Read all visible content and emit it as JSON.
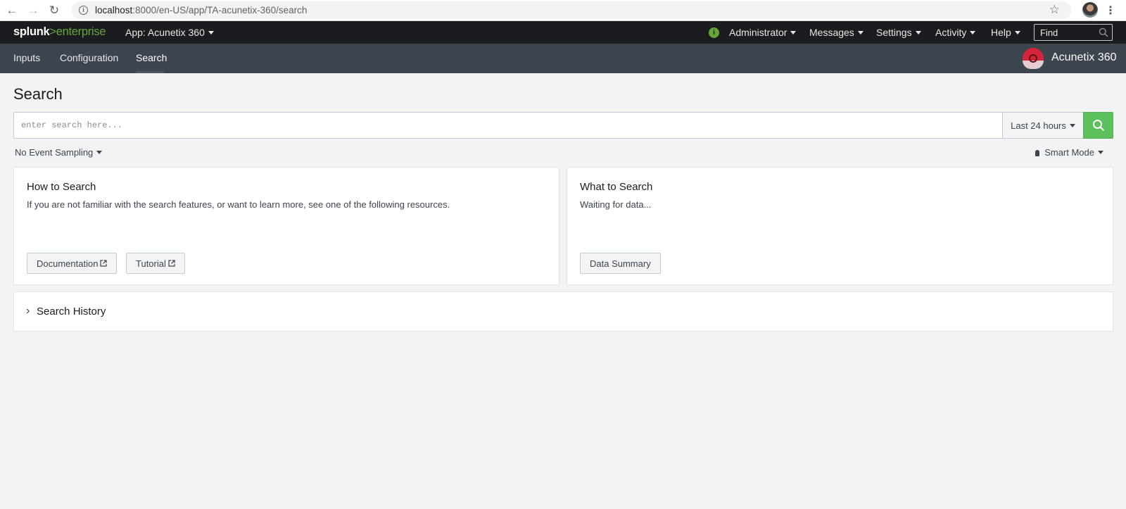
{
  "browser": {
    "url_host": "localhost",
    "url_path": ":8000/en-US/app/TA-acunetix-360/search"
  },
  "topbar": {
    "logo_part1": "splunk",
    "logo_part2": ">",
    "logo_part3": "enterprise",
    "app_menu": "App: Acunetix 360",
    "status_icon_glyph": "i",
    "nav": [
      {
        "label": "Administrator"
      },
      {
        "label": "Messages"
      },
      {
        "label": "Settings"
      },
      {
        "label": "Activity"
      },
      {
        "label": "Help"
      }
    ],
    "find_placeholder": "Find"
  },
  "appbar": {
    "tabs": [
      {
        "label": "Inputs"
      },
      {
        "label": "Configuration"
      },
      {
        "label": "Search",
        "active": true
      }
    ],
    "app_name": "Acunetix 360"
  },
  "main": {
    "title": "Search",
    "search": {
      "placeholder": "enter search here...",
      "value": "",
      "time_range": "Last 24 hours"
    },
    "sampling": "No Event Sampling",
    "mode": "Smart Mode",
    "how_to": {
      "title": "How to Search",
      "text": "If you are not familiar with the search features, or want to learn more, see one of the following resources.",
      "buttons": [
        {
          "label": "Documentation"
        },
        {
          "label": "Tutorial"
        }
      ]
    },
    "what_to": {
      "title": "What to Search",
      "text": "Waiting for data...",
      "button": "Data Summary"
    },
    "history": {
      "label": "Search History"
    }
  },
  "colors": {
    "brand_green": "#65a637",
    "search_button": "#5cc05c",
    "topbar_bg": "#1a1c20",
    "appbar_bg": "#3c444d",
    "app_logo_red": "#d6253a"
  }
}
